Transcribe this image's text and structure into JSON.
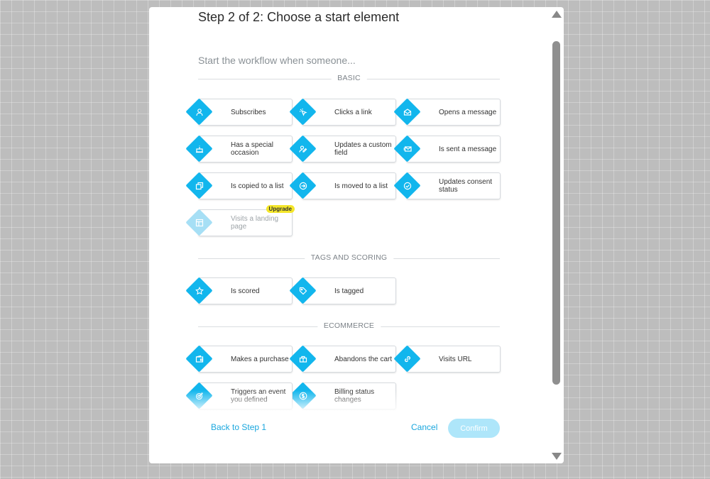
{
  "modal": {
    "title": "Step 2 of 2: Choose a start element",
    "subtitle": "Start the workflow when someone..."
  },
  "sections": {
    "basic": "BASIC",
    "tags": "TAGS AND SCORING",
    "ecommerce": "ECOMMERCE"
  },
  "cards": {
    "subscribes": {
      "label": "Subscribes",
      "icon": "user-icon"
    },
    "clicks_link": {
      "label": "Clicks a link",
      "icon": "cursor-click-icon"
    },
    "opens_message": {
      "label": "Opens a message",
      "icon": "open-envelope-icon"
    },
    "special_occasion": {
      "label": "Has a special occasion",
      "icon": "cake-icon"
    },
    "custom_field": {
      "label": "Updates a custom field",
      "icon": "user-edit-icon"
    },
    "sent_message": {
      "label": "Is sent a message",
      "icon": "send-envelope-icon"
    },
    "copied_list": {
      "label": "Is copied to a list",
      "icon": "copy-icon"
    },
    "moved_list": {
      "label": "Is moved to a list",
      "icon": "arrow-circle-icon"
    },
    "consent_status": {
      "label": "Updates consent status",
      "icon": "check-circle-icon"
    },
    "landing_page": {
      "label": "Visits a landing page",
      "icon": "layout-icon",
      "badge": "Upgrade"
    },
    "is_scored": {
      "label": "Is scored",
      "icon": "star-icon"
    },
    "is_tagged": {
      "label": "Is tagged",
      "icon": "tag-icon"
    },
    "purchase": {
      "label": "Makes a purchase",
      "icon": "wallet-icon"
    },
    "abandons_cart": {
      "label": "Abandons the cart",
      "icon": "basket-icon"
    },
    "visits_url": {
      "label": "Visits URL",
      "icon": "link-icon"
    },
    "triggers_event": {
      "label": "Triggers an event you defined",
      "icon": "target-icon"
    },
    "billing_status": {
      "label": "Billing status changes",
      "icon": "dollar-icon"
    }
  },
  "footer": {
    "back": "Back to Step 1",
    "cancel": "Cancel",
    "confirm": "Confirm"
  },
  "colors": {
    "accent": "#12b6ed",
    "accent_disabled": "#a6dff5",
    "link": "#1aa7de",
    "confirm_disabled": "#aee6fa",
    "badge": "#f4e62a"
  }
}
